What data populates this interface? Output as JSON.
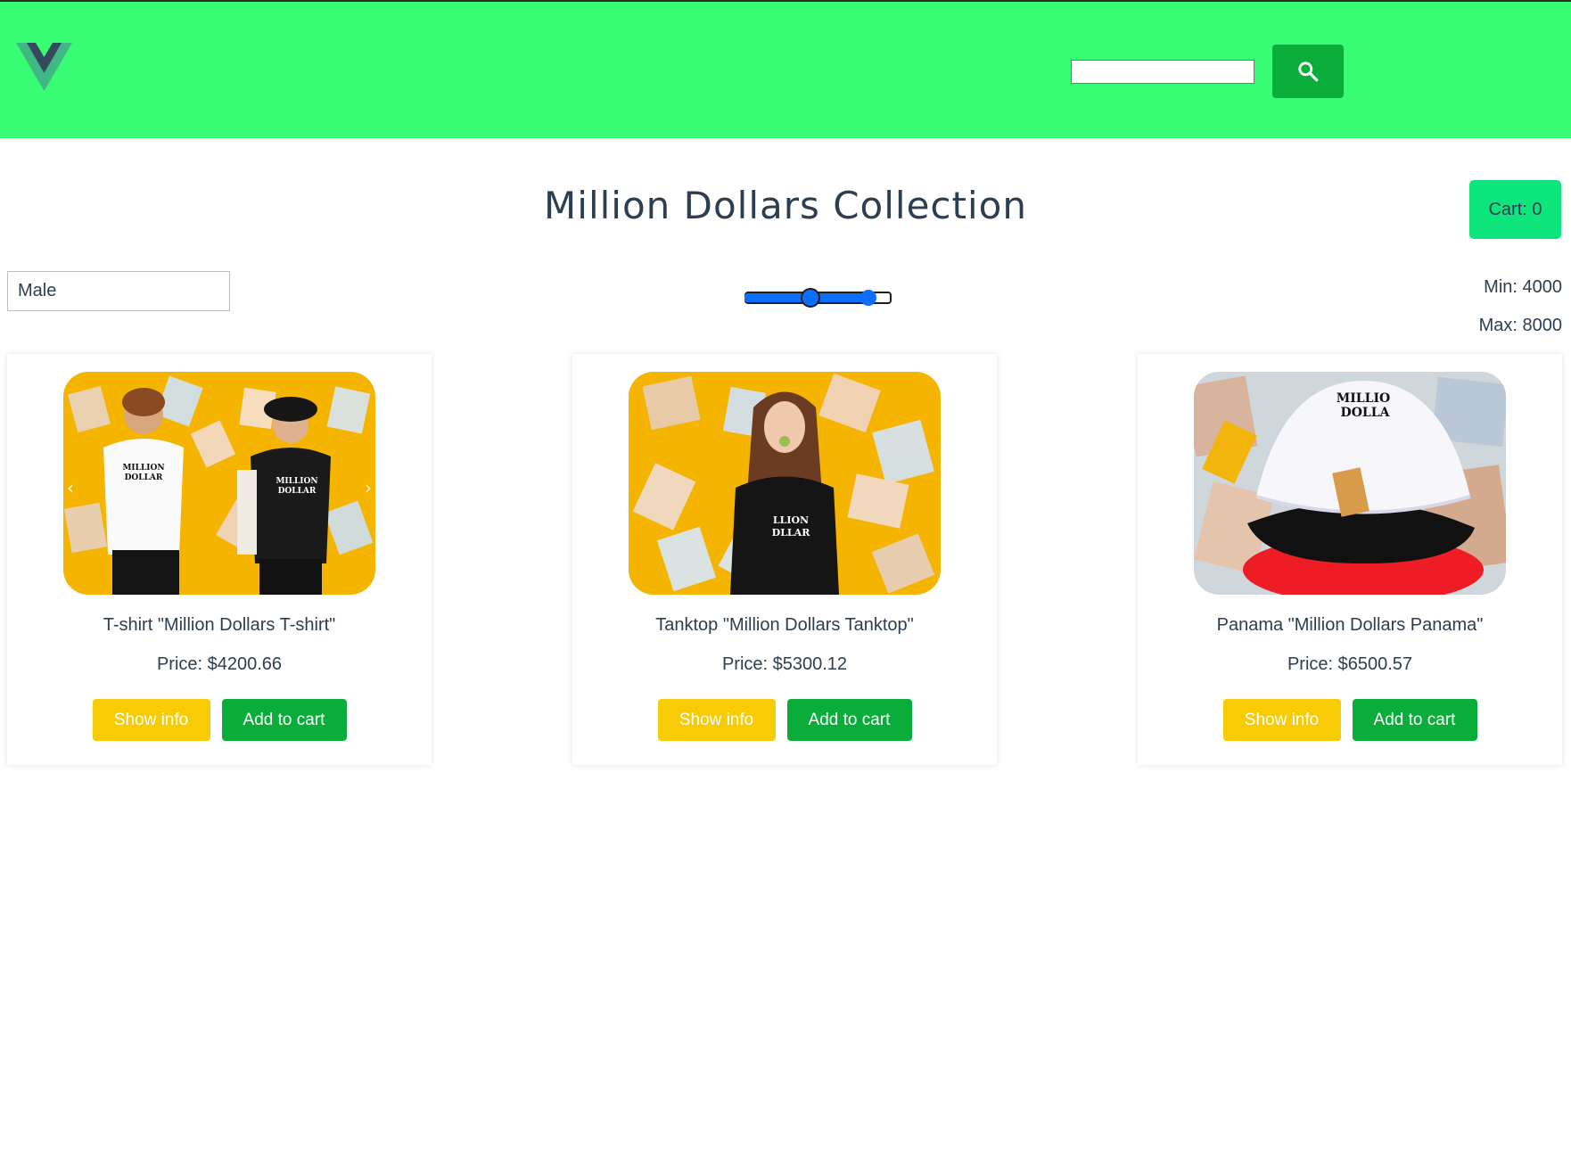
{
  "header": {
    "logo_icon": "vue-logo-icon",
    "search": {
      "value": "",
      "placeholder": ""
    },
    "search_icon": "search-icon",
    "colors": {
      "background": "#38fd74",
      "search_button": "#0aad3a"
    }
  },
  "main": {
    "title": "Million Dollars Collection",
    "cart_label": "Cart: 0",
    "filters": {
      "gender_selected": "Male",
      "price_min_label": "Min: 4000",
      "price_max_label": "Max: 8000",
      "slider_low_fraction": 0.45,
      "slider_high_fraction": 0.84
    }
  },
  "products": [
    {
      "name": "T-shirt \"Million Dollars T-shirt\"",
      "price": "Price: $4200.66",
      "show_info": "Show info",
      "add_to_cart": "Add to cart"
    },
    {
      "name": "Tanktop \"Million Dollars Tanktop\"",
      "price": "Price: $5300.12",
      "show_info": "Show info",
      "add_to_cart": "Add to cart"
    },
    {
      "name": "Panama \"Million Dollars Panama\"",
      "price": "Price: $6500.57",
      "show_info": "Show info",
      "add_to_cart": "Add to cart"
    }
  ],
  "colors": {
    "show_info_button": "#f7cc06",
    "add_to_cart_button": "#0aad3a",
    "cart_button": "#0ee57d",
    "slider": "#0d6efd"
  }
}
